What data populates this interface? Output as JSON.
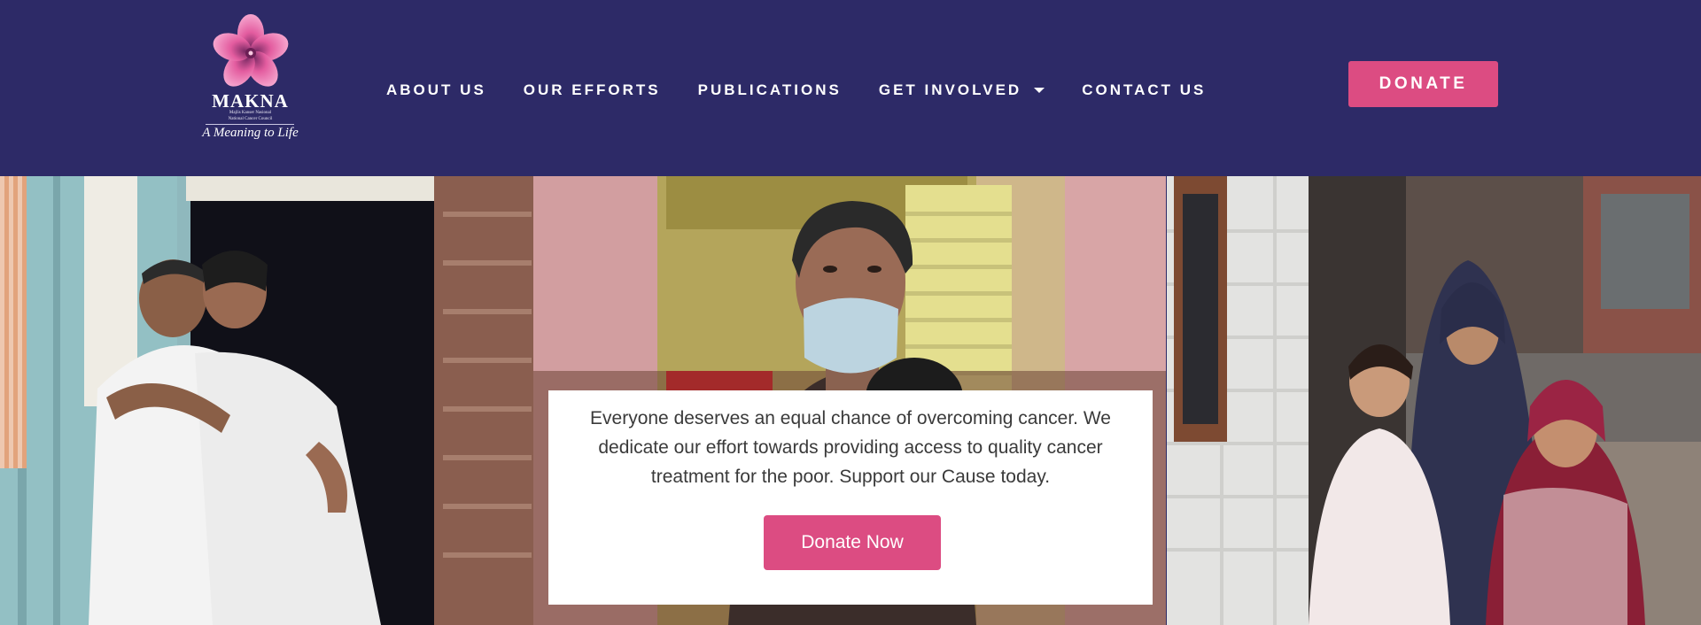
{
  "logo": {
    "name": "MAKNA",
    "subtitle_line1": "Majlis Kanser Nasional",
    "subtitle_line2": "National Cancer Council",
    "tagline": "A Meaning to Life"
  },
  "nav": {
    "items": [
      {
        "label": "ABOUT US",
        "has_dropdown": false
      },
      {
        "label": "OUR EFFORTS",
        "has_dropdown": false
      },
      {
        "label": "PUBLICATIONS",
        "has_dropdown": false
      },
      {
        "label": "GET INVOLVED",
        "has_dropdown": true
      },
      {
        "label": "CONTACT US",
        "has_dropdown": false
      }
    ]
  },
  "header": {
    "donate_label": "DONATE"
  },
  "cta": {
    "text": "Everyone deserves an equal chance of overcoming cancer. We dedicate our effort towards providing access to quality cancer treatment for the poor. Support our Cause today.",
    "button_label": "Donate Now"
  },
  "colors": {
    "header_bg": "#2d2a67",
    "accent_pink": "#dc4c82",
    "text_white": "#ffffff",
    "body_text": "#3a3a3a"
  },
  "icons": {
    "logo": "pink-flower-icon",
    "dropdown": "caret-down-icon"
  }
}
